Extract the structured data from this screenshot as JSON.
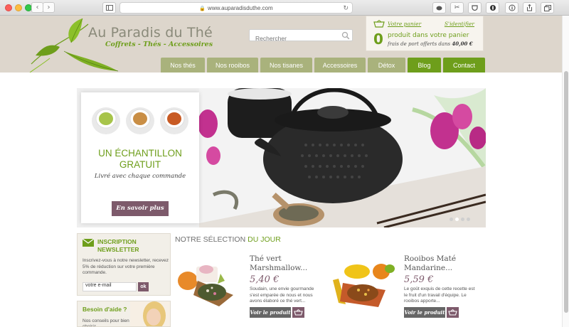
{
  "browser": {
    "url": "www.auparadisduthe.com",
    "back_icon": "‹",
    "forward_icon": "›"
  },
  "site": {
    "name": "Au Paradis du Thé",
    "tagline": "Coffrets - Thés - Accessoires"
  },
  "search": {
    "placeholder": "Rechercher"
  },
  "cart": {
    "label": "Votre panier",
    "identify": "S'identifier",
    "count": "0",
    "count_text": "produit dans votre panier",
    "shipping_prefix": "frais de port offerts dans",
    "shipping_amount": "40,00 €"
  },
  "nav": [
    {
      "label": "Nos thés"
    },
    {
      "label": "Nos rooibos"
    },
    {
      "label": "Nos tisanes"
    },
    {
      "label": "Accessoires"
    },
    {
      "label": "Détox"
    },
    {
      "label": "Blog"
    },
    {
      "label": "Contact"
    }
  ],
  "banner": {
    "title_line1": "UN ÉCHANTILLON",
    "title_line2": "GRATUIT",
    "subtitle": "Livré avec chaque commande",
    "button": "En savoir plus"
  },
  "newsletter": {
    "title_line1": "INSCRIPTION",
    "title_line2": "NEWSLETTER",
    "description": "Inscrivez-vous à notre newsletter, recevez 5% de réduction sur votre première commande.",
    "email_value": "votre e-mail",
    "submit": "ok"
  },
  "help": {
    "title": "Besoin d'aide ?",
    "description": "Nos conseils pour bien choisir"
  },
  "selection": {
    "title_part1": "NOTRE SÉLECTION",
    "title_part2": "DU JOUR",
    "products": [
      {
        "name_line1": "Thé vert",
        "name_line2": "Marshmallow...",
        "price": "5,40 €",
        "description": "Soudain, une envie gourmande s'est emparée de nous et nous avons élaboré ce thé vert...",
        "button": "Voir le produit"
      },
      {
        "name_line1": "Rooibos Maté",
        "name_line2": "Mandarine...",
        "price": "5,59 €",
        "description": "Le goût exquis de cette recette est le fruit d'un travail d'équipe. Le rooibos apporte...",
        "button": "Voir le produit"
      }
    ]
  },
  "colors": {
    "brand_green": "#6e9e1b",
    "nav_olive": "#a9b27c",
    "accent_mauve": "#7d5a6b",
    "header_beige": "#ddd6cc"
  }
}
